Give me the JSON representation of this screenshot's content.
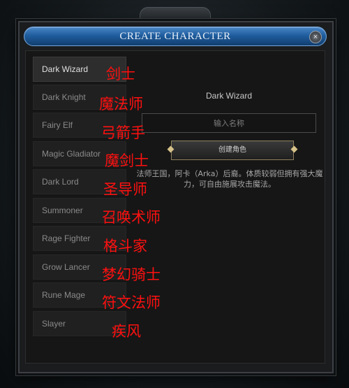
{
  "window": {
    "title": "CREATE CHARACTER",
    "close_label": "×"
  },
  "classes": [
    {
      "label": "Dark Wizard",
      "annotation": "剑士",
      "selected": true
    },
    {
      "label": "Dark Knight",
      "annotation": "魔法师"
    },
    {
      "label": "Fairy Elf",
      "annotation": "弓箭手"
    },
    {
      "label": "Magic Gladiator",
      "annotation": "魔剑士"
    },
    {
      "label": "Dark Lord",
      "annotation": "圣导师"
    },
    {
      "label": "Summoner",
      "annotation": "召唤术师"
    },
    {
      "label": "Rage Fighter",
      "annotation": "格斗家"
    },
    {
      "label": "Grow Lancer",
      "annotation": "梦幻骑士"
    },
    {
      "label": "Rune Mage",
      "annotation": "符文法师"
    },
    {
      "label": "Slayer",
      "annotation": "疾风"
    }
  ],
  "detail": {
    "selected_name": "Dark Wizard",
    "name_input": {
      "placeholder": "输入名称",
      "value": ""
    },
    "create_button_label": "创建角色",
    "description": "法师王国，阿卡（Arka）后裔。体质较弱但拥有强大魔力，可自由施展攻击魔法。"
  },
  "colors": {
    "title_bar": "#1f5d9e",
    "annotation": "#ff1010",
    "button_border": "#8f805c"
  }
}
